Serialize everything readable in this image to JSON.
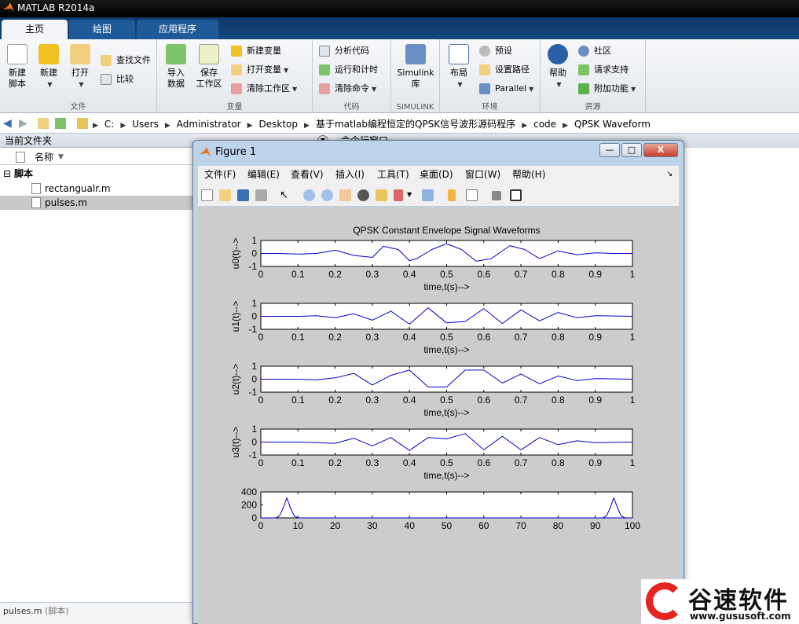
{
  "app": {
    "title": "MATLAB R2014a"
  },
  "tabs": [
    {
      "label": "主页"
    },
    {
      "label": "绘图"
    },
    {
      "label": "应用程序"
    }
  ],
  "ribbon": {
    "file": {
      "label": "文件",
      "new_script": "新建\n脚本",
      "new": "新建",
      "open": "打开",
      "find_files": "查找文件",
      "compare": "比较"
    },
    "variable": {
      "label": "变量",
      "import": "导入\n数据",
      "save_ws": "保存\n工作区",
      "new_var": "新建变量",
      "open_var": "打开变量",
      "clear_ws": "清除工作区"
    },
    "code": {
      "label": "代码",
      "analyze": "分析代码",
      "run_time": "运行和计时",
      "clear_cmd": "清除命令"
    },
    "simulink": {
      "label": "SIMULINK",
      "lib": "Simulink\n库"
    },
    "env": {
      "label": "环境",
      "layout": "布局",
      "prefs": "预设",
      "set_path": "设置路径",
      "parallel": "Parallel"
    },
    "resources": {
      "label": "资源",
      "help": "帮助",
      "community": "社区",
      "support": "请求支持",
      "addons": "附加功能"
    }
  },
  "address": {
    "crumbs": [
      "C:",
      "Users",
      "Administrator",
      "Desktop",
      "基于matlab编程恒定的QPSK信号波形源码程序",
      "code",
      "QPSK Waveform"
    ]
  },
  "current_folder": {
    "title": "当前文件夹",
    "col_name": "名称",
    "group": "脚本",
    "files": [
      "rectangualr.m",
      "pulses.m"
    ],
    "status": "pulses.m",
    "status_suffix": "(脚本)"
  },
  "command_window": {
    "title": "命令行窗口"
  },
  "figure": {
    "title": "Figure 1",
    "menu": [
      "文件(F)",
      "编辑(E)",
      "查看(V)",
      "插入(I)",
      "工具(T)",
      "桌面(D)",
      "窗口(W)",
      "帮助(H)"
    ],
    "buttons": {
      "min": "—",
      "max": "□",
      "close": "X"
    }
  },
  "chart_data": [
    {
      "type": "line",
      "title": "QPSK Constant Envelope Signal Waveforms",
      "xlabel": "time,t(s)-->",
      "ylabel": "u0(t)-->",
      "xlim": [
        0,
        1
      ],
      "ylim": [
        -1,
        1
      ],
      "xticks": [
        "0",
        "0.1",
        "0.2",
        "0.3",
        "0.4",
        "0.5",
        "0.6",
        "0.7",
        "0.8",
        "0.9",
        "1"
      ],
      "yticks": [
        "1",
        "0",
        "-1"
      ],
      "series": [
        {
          "x": [
            0,
            0.05,
            0.1,
            0.15,
            0.2,
            0.25,
            0.3,
            0.33,
            0.37,
            0.4,
            0.42,
            0.46,
            0.5,
            0.54,
            0.58,
            0.62,
            0.67,
            0.71,
            0.75,
            0.8,
            0.85,
            0.9,
            0.95,
            1
          ],
          "y": [
            0,
            0,
            -0.05,
            0,
            0.25,
            -0.15,
            -0.3,
            0.55,
            0.3,
            -0.55,
            -0.4,
            0.3,
            0.75,
            0.3,
            -0.6,
            -0.4,
            0.6,
            0.3,
            -0.4,
            0.2,
            -0.1,
            0.05,
            0,
            0
          ]
        }
      ]
    },
    {
      "type": "line",
      "xlabel": "time,t(s)-->",
      "ylabel": "u1(t)-->",
      "xlim": [
        0,
        1
      ],
      "ylim": [
        -1,
        1
      ],
      "xticks": [
        "0",
        "0.1",
        "0.2",
        "0.3",
        "0.4",
        "0.5",
        "0.6",
        "0.7",
        "0.8",
        "0.9",
        "1"
      ],
      "yticks": [
        "1",
        "0",
        "-1"
      ],
      "series": [
        {
          "x": [
            0,
            0.1,
            0.15,
            0.2,
            0.25,
            0.3,
            0.35,
            0.4,
            0.45,
            0.5,
            0.55,
            0.6,
            0.65,
            0.7,
            0.75,
            0.8,
            0.85,
            0.9,
            1
          ],
          "y": [
            0,
            0,
            0.05,
            -0.1,
            0.2,
            -0.3,
            0.4,
            -0.6,
            0.65,
            -0.5,
            -0.4,
            0.6,
            -0.55,
            0.5,
            -0.35,
            0.3,
            -0.1,
            0.05,
            0
          ]
        }
      ]
    },
    {
      "type": "line",
      "xlabel": "time,t(s)-->",
      "ylabel": "u2(t)-->",
      "xlim": [
        0,
        1
      ],
      "ylim": [
        -1,
        1
      ],
      "xticks": [
        "0",
        "0.1",
        "0.2",
        "0.3",
        "0.4",
        "0.5",
        "0.6",
        "0.7",
        "0.8",
        "0.9",
        "1"
      ],
      "yticks": [
        "1",
        "0",
        "-1"
      ],
      "series": [
        {
          "x": [
            0,
            0.1,
            0.15,
            0.2,
            0.25,
            0.3,
            0.35,
            0.4,
            0.45,
            0.5,
            0.55,
            0.6,
            0.65,
            0.7,
            0.75,
            0.8,
            0.85,
            0.9,
            1
          ],
          "y": [
            0,
            0,
            -0.05,
            0.1,
            0.45,
            -0.45,
            0.3,
            0.7,
            -0.6,
            -0.6,
            0.7,
            0.7,
            -0.3,
            0.4,
            -0.35,
            0.25,
            -0.1,
            0.05,
            0
          ]
        }
      ]
    },
    {
      "type": "line",
      "xlabel": "time,t(s)-->",
      "ylabel": "u3(t)-->",
      "xlim": [
        0,
        1
      ],
      "ylim": [
        -1,
        1
      ],
      "xticks": [
        "0",
        "0.1",
        "0.2",
        "0.3",
        "0.4",
        "0.5",
        "0.6",
        "0.7",
        "0.8",
        "0.9",
        "1"
      ],
      "yticks": [
        "1",
        "0",
        "-1"
      ],
      "series": [
        {
          "x": [
            0,
            0.1,
            0.15,
            0.2,
            0.25,
            0.3,
            0.35,
            0.4,
            0.45,
            0.5,
            0.55,
            0.6,
            0.65,
            0.7,
            0.75,
            0.8,
            0.85,
            0.9,
            1
          ],
          "y": [
            0,
            0,
            -0.05,
            -0.1,
            0.3,
            -0.3,
            0.35,
            -0.65,
            0.35,
            0.25,
            0.65,
            -0.6,
            0.45,
            -0.6,
            0.35,
            -0.2,
            0.1,
            -0.05,
            0
          ]
        }
      ]
    },
    {
      "type": "line",
      "xlim": [
        0,
        100
      ],
      "ylim": [
        0,
        400
      ],
      "xticks": [
        "0",
        "10",
        "20",
        "30",
        "40",
        "50",
        "60",
        "70",
        "80",
        "90",
        "100"
      ],
      "yticks": [
        "400",
        "200",
        "0"
      ],
      "series": [
        {
          "x": [
            0,
            4,
            5,
            6,
            7,
            8,
            9,
            10,
            100
          ],
          "y": [
            0,
            0,
            30,
            150,
            310,
            150,
            30,
            0,
            0
          ]
        },
        {
          "x": [
            92,
            93,
            94,
            95,
            96,
            97,
            98
          ],
          "y": [
            0,
            30,
            150,
            310,
            150,
            30,
            0
          ]
        }
      ]
    }
  ],
  "brand": {
    "name": "谷速软件",
    "url": "www.gususoft.com"
  }
}
